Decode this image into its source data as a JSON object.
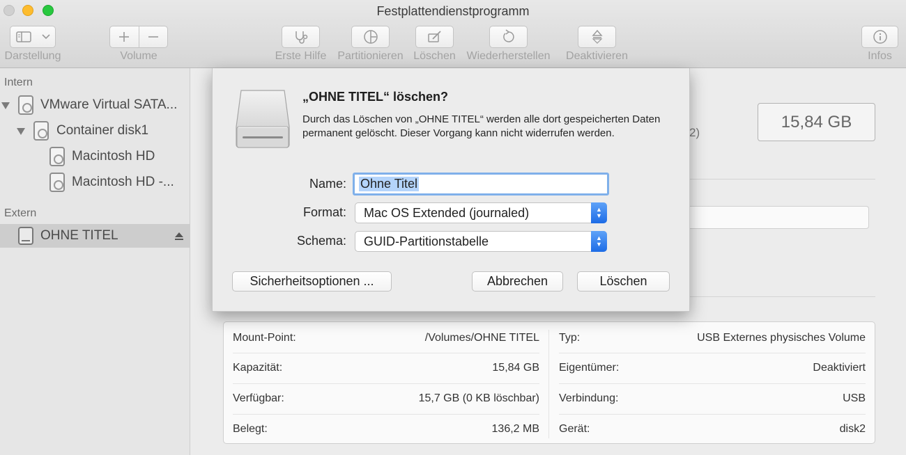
{
  "window": {
    "title": "Festplattendienstprogramm"
  },
  "toolbar": {
    "view_label": "Darstellung",
    "volume_label": "Volume",
    "first_aid_label": "Erste Hilfe",
    "partition_label": "Partitionieren",
    "erase_label": "Löschen",
    "restore_label": "Wiederherstellen",
    "unmount_label": "Deaktivieren",
    "info_label": "Infos"
  },
  "sidebar": {
    "internal_header": "Intern",
    "external_header": "Extern",
    "items": [
      {
        "label": "VMware Virtual SATA...",
        "icon": "internal-disk-icon"
      },
      {
        "label": "Container disk1",
        "icon": "container-disk-icon"
      },
      {
        "label": "Macintosh HD",
        "icon": "volume-icon"
      },
      {
        "label": "Macintosh HD -...",
        "icon": "volume-icon"
      },
      {
        "label": "OHNE TITEL",
        "icon": "external-disk-icon",
        "selected": true
      }
    ]
  },
  "main": {
    "capacity_badge": "15,84 GB",
    "paren_fragment": "2)"
  },
  "info_table": {
    "left": [
      {
        "key": "Mount-Point:",
        "value": "/Volumes/OHNE TITEL"
      },
      {
        "key": "Kapazität:",
        "value": "15,84 GB"
      },
      {
        "key": "Verfügbar:",
        "value": "15,7 GB (0 KB löschbar)"
      },
      {
        "key": "Belegt:",
        "value": "136,2 MB"
      }
    ],
    "right": [
      {
        "key": "Typ:",
        "value": "USB Externes physisches Volume"
      },
      {
        "key": "Eigentümer:",
        "value": "Deaktiviert"
      },
      {
        "key": "Verbindung:",
        "value": "USB"
      },
      {
        "key": "Gerät:",
        "value": "disk2"
      }
    ]
  },
  "dialog": {
    "title": "„OHNE TITEL“ löschen?",
    "message": "Durch das Löschen von „OHNE TITEL“ werden alle dort gespeicherten Daten permanent gelöscht. Dieser Vorgang kann nicht widerrufen werden.",
    "name_label": "Name:",
    "name_value": "Ohne Titel",
    "format_label": "Format:",
    "format_value": "Mac OS Extended (journaled)",
    "scheme_label": "Schema:",
    "scheme_value": "GUID-Partitionstabelle",
    "security_button": "Sicherheitsoptionen ...",
    "cancel_button": "Abbrechen",
    "erase_button": "Löschen",
    "accent_color": "#1d6ce6"
  }
}
